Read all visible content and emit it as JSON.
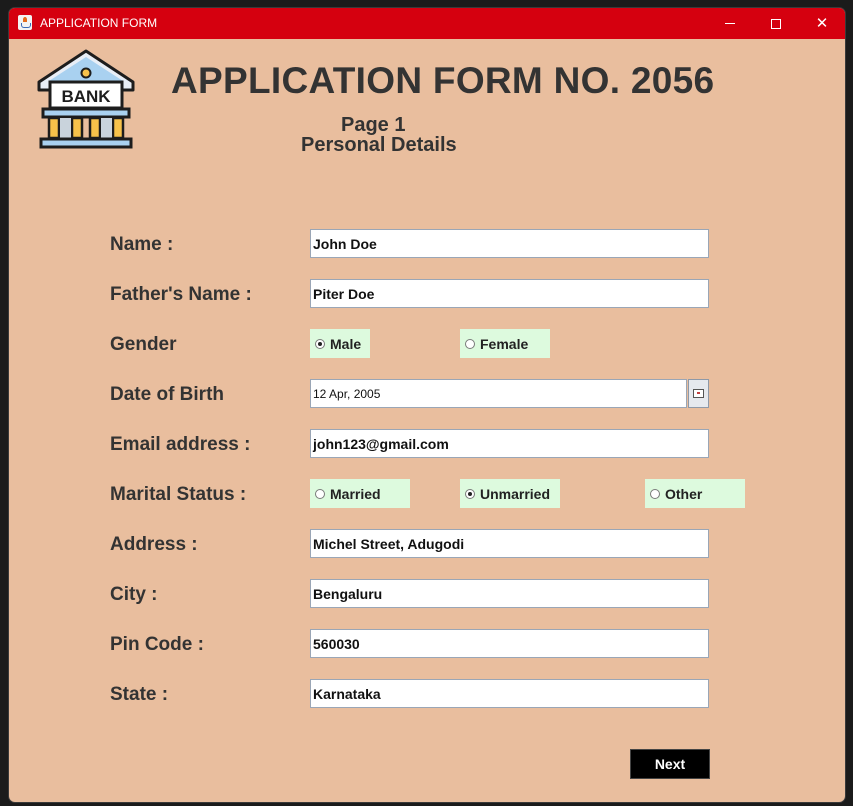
{
  "window": {
    "title": "APPLICATION FORM"
  },
  "logo": {
    "text": "BANK"
  },
  "header": {
    "title": "APPLICATION FORM NO. 2056",
    "page": "Page 1",
    "section": "Personal Details"
  },
  "form": {
    "name": {
      "label": "Name :",
      "value": "John Doe"
    },
    "father_name": {
      "label": "Father's Name :",
      "value": "Piter Doe"
    },
    "gender": {
      "label": "Gender",
      "options": [
        {
          "label": "Male",
          "selected": true
        },
        {
          "label": "Female",
          "selected": false
        }
      ]
    },
    "dob": {
      "label": "Date of Birth",
      "value": "12 Apr, 2005"
    },
    "email": {
      "label": "Email address :",
      "value": "john123@gmail.com"
    },
    "marital": {
      "label": "Marital Status :",
      "options": [
        {
          "label": "Married",
          "selected": false
        },
        {
          "label": "Unmarried",
          "selected": true
        },
        {
          "label": "Other",
          "selected": false
        }
      ]
    },
    "address": {
      "label": "Address :",
      "value": "Michel Street, Adugodi"
    },
    "city": {
      "label": "City :",
      "value": "Bengaluru"
    },
    "pin": {
      "label": "Pin Code :",
      "value": "560030"
    },
    "state": {
      "label": "State :",
      "value": "Karnataka"
    }
  },
  "actions": {
    "next_label": "Next"
  },
  "colors": {
    "titlebar": "#d5000f",
    "window_bg": "#e9be9e",
    "radio_bg": "#ddfade",
    "button_bg": "#000000"
  }
}
